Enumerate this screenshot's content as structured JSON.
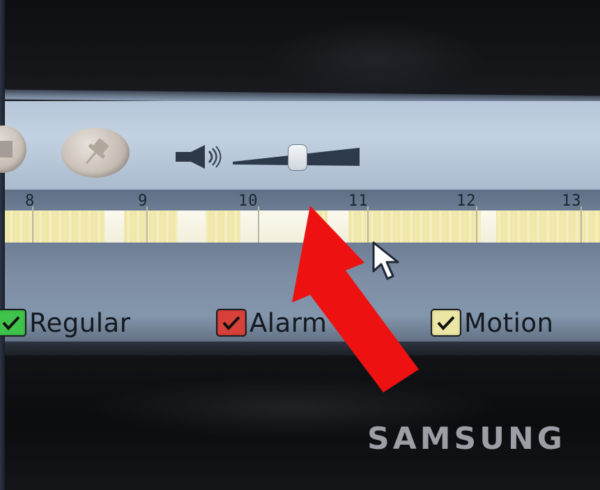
{
  "toolbar": {
    "buttons": [
      {
        "icon": "stop-icon"
      },
      {
        "icon": "pushpin-icon"
      }
    ],
    "volume": {
      "icon": "speaker-icon",
      "level": 0.5
    }
  },
  "timeline": {
    "ticks": [
      "8",
      "9",
      "10",
      "11",
      "12",
      "13"
    ]
  },
  "legend": {
    "items": [
      {
        "label": "Regular",
        "color": "#3fc34a"
      },
      {
        "label": "Alarm",
        "color": "#d8413a"
      },
      {
        "label": "Motion",
        "color": "#ece6a4"
      }
    ]
  },
  "monitor": {
    "brand": "SAMSUNG"
  },
  "colors": {
    "toolbar": "#c3d2e2",
    "timeline_band": "#6d7d94",
    "recording": "#efe6a6",
    "annotation_arrow": "#ee1111"
  }
}
